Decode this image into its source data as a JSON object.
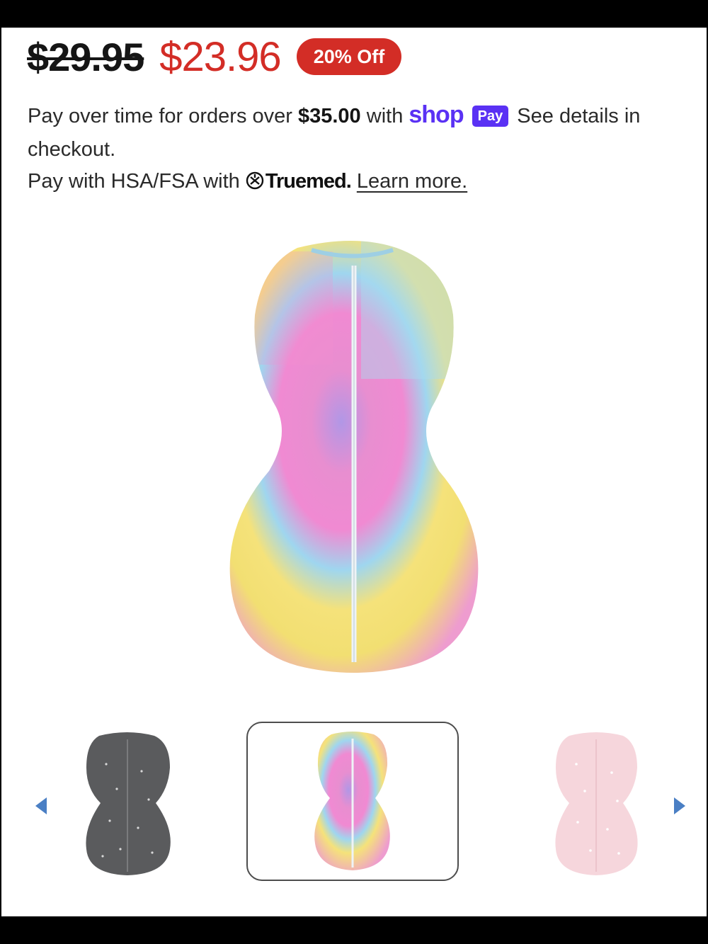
{
  "price": {
    "original": "$29.95",
    "sale": "$23.96",
    "discount_badge": "20% Off"
  },
  "payment": {
    "line1_prefix": "Pay over time for orders over ",
    "threshold": "$35.00",
    "line1_with": " with ",
    "shop_logo": "shop",
    "shop_pay_pill": "Pay",
    "line1_suffix": " See details in checkout.",
    "hsa_prefix": "Pay with HSA/FSA with ",
    "truemed_logo": "Truemed.",
    "learn_more": "Learn more."
  },
  "gallery": {
    "main_image": "tie-dye-swaddle-main",
    "thumbnails": [
      {
        "name": "charcoal-stars-swaddle"
      },
      {
        "name": "tie-dye-swaddle",
        "selected": true
      },
      {
        "name": "pink-stars-swaddle"
      }
    ],
    "prev_icon": "triangle-left-icon",
    "next_icon": "triangle-right-icon"
  },
  "colors": {
    "sale_red": "#d32d26",
    "shop_purple": "#5a31f4",
    "arrow_blue": "#4a7fc4"
  }
}
